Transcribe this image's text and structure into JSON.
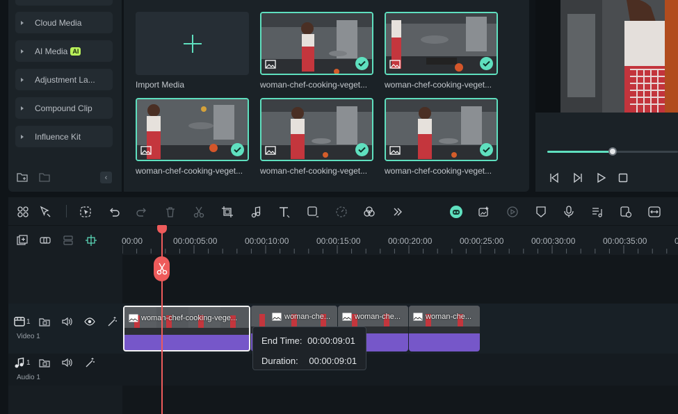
{
  "sidebar": {
    "items": [
      {
        "label": "Cloud Media"
      },
      {
        "label": "AI Media",
        "badge": "AI"
      },
      {
        "label": "Adjustment La..."
      },
      {
        "label": "Compound Clip"
      },
      {
        "label": "Influence Kit"
      }
    ]
  },
  "media": {
    "import_label": "Import Media",
    "items": [
      {
        "label": "woman-chef-cooking-veget..."
      },
      {
        "label": "woman-chef-cooking-veget..."
      },
      {
        "label": "woman-chef-cooking-veget..."
      },
      {
        "label": "woman-chef-cooking-veget..."
      },
      {
        "label": "woman-chef-cooking-veget..."
      }
    ]
  },
  "player": {
    "progress": 0.5
  },
  "ruler": {
    "ticks": [
      "00:00",
      "00:00:05:00",
      "00:00:10:00",
      "00:00:15:00",
      "00:00:20:00",
      "00:00:25:00",
      "00:00:30:00",
      "00:00:35:00",
      "0"
    ]
  },
  "tracks": {
    "video": {
      "number": "1",
      "name": "Video 1"
    },
    "audio": {
      "number": "1",
      "name": "Audio 1"
    }
  },
  "clips": [
    {
      "title": "woman-chef-cooking-vege..."
    },
    {
      "title": "woman-che..."
    },
    {
      "title": "woman-che..."
    },
    {
      "title": "woman-che..."
    }
  ],
  "tooltip": {
    "end_label": "End Time:",
    "end_value": "00:00:09:01",
    "duration_label": "Duration:",
    "duration_value": "00:00:09:01"
  },
  "colors": {
    "accent": "#5fe0bf",
    "clip": "#7657c9",
    "playhead": "#ee5b5b",
    "ai_badge": "#b8f05a"
  }
}
